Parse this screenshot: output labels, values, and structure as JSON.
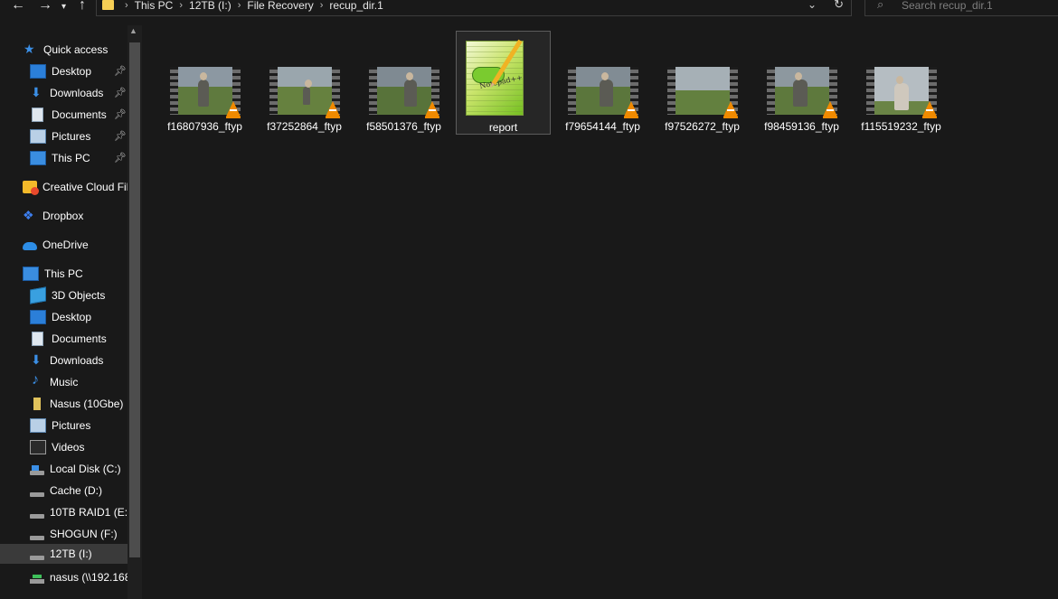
{
  "toolbar": {
    "back_icon": "back-arrow-icon",
    "forward_icon": "forward-arrow-icon",
    "recent_icon": "chevron-down-icon",
    "up_icon": "up-arrow-icon"
  },
  "address": {
    "breadcrumbs": [
      "This PC",
      "12TB (I:)",
      "File Recovery",
      "recup_dir.1"
    ],
    "separator": "›"
  },
  "search": {
    "placeholder": "Search recup_dir.1"
  },
  "nav": {
    "quick_access": [
      {
        "label": "Quick access",
        "icon": "star-icon"
      },
      {
        "label": "Desktop",
        "icon": "desktop-icon",
        "pinned": true
      },
      {
        "label": "Downloads",
        "icon": "download-icon",
        "pinned": true
      },
      {
        "label": "Documents",
        "icon": "document-icon",
        "pinned": true
      },
      {
        "label": "Pictures",
        "icon": "pictures-icon",
        "pinned": true
      },
      {
        "label": "This PC",
        "icon": "computer-icon",
        "pinned": true
      }
    ],
    "roots": [
      {
        "label": "Creative Cloud Fil",
        "icon": "creative-cloud-icon"
      },
      {
        "label": "Dropbox",
        "icon": "dropbox-icon"
      },
      {
        "label": "OneDrive",
        "icon": "onedrive-icon"
      },
      {
        "label": "This PC",
        "icon": "computer-icon"
      }
    ],
    "this_pc": [
      {
        "label": "3D Objects",
        "icon": "3d-objects-icon"
      },
      {
        "label": "Desktop",
        "icon": "desktop-icon"
      },
      {
        "label": "Documents",
        "icon": "document-icon"
      },
      {
        "label": "Downloads",
        "icon": "download-icon"
      },
      {
        "label": "Music",
        "icon": "music-icon"
      },
      {
        "label": "Nasus (10Gbe)",
        "icon": "usb-drive-icon"
      },
      {
        "label": "Pictures",
        "icon": "pictures-icon"
      },
      {
        "label": "Videos",
        "icon": "videos-icon"
      },
      {
        "label": "Local Disk (C:)",
        "icon": "system-drive-icon"
      },
      {
        "label": "Cache (D:)",
        "icon": "drive-icon"
      },
      {
        "label": "10TB RAID1 (E:)",
        "icon": "drive-icon"
      },
      {
        "label": "SHOGUN (F:)",
        "icon": "drive-icon"
      },
      {
        "label": "12TB (I:)",
        "icon": "drive-icon",
        "selected": true
      },
      {
        "label": "nasus (\\\\192.168",
        "icon": "network-drive-icon"
      }
    ]
  },
  "files": [
    {
      "name": "f16807936_ftyp",
      "type": "video"
    },
    {
      "name": "f37252864_ftyp",
      "type": "video"
    },
    {
      "name": "f58501376_ftyp",
      "type": "video"
    },
    {
      "name": "report",
      "type": "text",
      "selected": true
    },
    {
      "name": "f79654144_ftyp",
      "type": "video"
    },
    {
      "name": "f97526272_ftyp",
      "type": "video"
    },
    {
      "name": "f98459136_ftyp",
      "type": "video"
    },
    {
      "name": "f115519232_ftyp",
      "type": "video"
    }
  ],
  "colors": {
    "background": "#191919",
    "selection": "#3a3a3a",
    "accent": "#3b8fe6",
    "vlc_orange": "#f08a00"
  }
}
